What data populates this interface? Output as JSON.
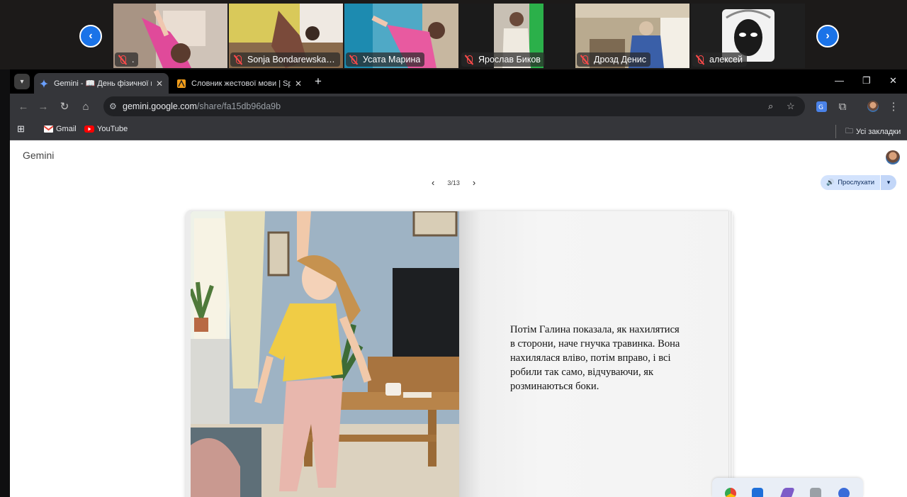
{
  "call": {
    "participants": [
      {
        "name": "."
      },
      {
        "name": "Sonja Bondarewskaja ..."
      },
      {
        "name": "Усата Марина"
      },
      {
        "name": "Ярослав Биков"
      },
      {
        "name": "Дрозд Денис"
      },
      {
        "name": "алексей"
      }
    ],
    "prev_arrow": "‹",
    "next_arrow": "›"
  },
  "browser": {
    "tabs": [
      {
        "title": "Gemini - 📖 День фізичної культури",
        "active": true
      },
      {
        "title": "Словник жестової мови | Spread The Sign",
        "active": false
      }
    ],
    "new_tab": "+",
    "window_controls": {
      "minimize": "—",
      "maximize": "❐",
      "close": "✕"
    },
    "url_host": "gemini.google.com",
    "url_path": "/share/fa15db96da9b",
    "bookmarks": [
      {
        "label": "Gmail"
      },
      {
        "label": "YouTube"
      }
    ],
    "all_bookmarks": "Усі закладки"
  },
  "page": {
    "app_name": "Gemini",
    "pager": "3/13",
    "listen_label": "Прослухати",
    "story_text": "Потім Галина показала, як нахилятися в сторони, наче гнучка травинка. Вона нахилялася вліво, потім вправо, і всі робили так само, відчуваючи, як розминаються боки."
  },
  "colors": {
    "accent": "#1a73e8",
    "mic_off": "#ff4a4a",
    "listen_bg": "#d3e3fd",
    "toolbar": "#35363a"
  },
  "icons": {
    "tab_search": "chevron-down-icon",
    "back": "arrow-left-icon",
    "forward": "arrow-right-icon",
    "reload": "reload-icon",
    "home": "home-icon",
    "zoom": "search-icon",
    "bookmark_star": "star-icon",
    "translate": "translate-icon",
    "extensions": "puzzle-icon",
    "menu": "kebab-menu-icon",
    "apps": "apps-grid-icon",
    "folder": "folder-icon",
    "speaker": "speaker-icon"
  }
}
